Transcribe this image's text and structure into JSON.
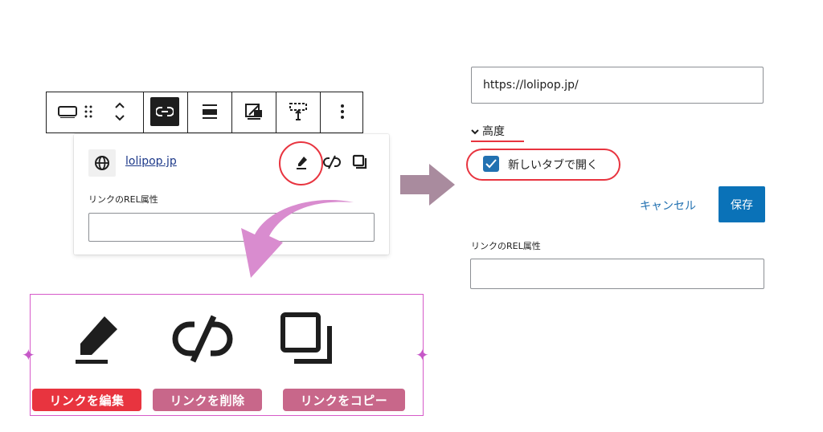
{
  "toolbar": {
    "icons": [
      "block-icon",
      "drag-handle-icon",
      "move-up-down-icon",
      "link-icon",
      "align-icon",
      "media-text-icon",
      "height-icon",
      "more-options-icon"
    ]
  },
  "popover": {
    "link_text": "lolipop.jp",
    "rel_label": "リンクのREL属性",
    "rel_value": ""
  },
  "callout": {
    "edit_tag": "リンクを編集",
    "unlink_tag": "リンクを削除",
    "copy_tag": "リンクをコピー",
    "edit_color": "#e8343f",
    "tag_color": "#c8678a"
  },
  "settings": {
    "url_value": "https://lolipop.jp/",
    "advanced_label": "高度",
    "new_tab_label": "新しいタブで開く",
    "new_tab_checked": true,
    "cancel_label": "キャンセル",
    "save_label": "保存",
    "rel_label": "リンクのREL属性",
    "rel_value": ""
  },
  "colors": {
    "accent": "#2271b1",
    "highlight": "#e8343f",
    "arrow_pink": "#d98ccf",
    "arrow_gray": "#a98b9e"
  }
}
